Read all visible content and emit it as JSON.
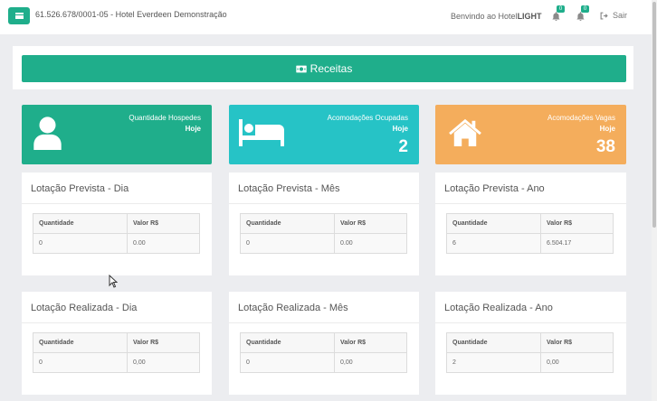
{
  "header": {
    "site_title": "61.526.678/0001-05 - Hotel Everdeen Demonstração",
    "welcome_prefix": "Benvindo ao Hotel",
    "welcome_brand": "LIGHT",
    "notifications_badge_1": "0",
    "notifications_badge_2": "0",
    "logout_label": "Sair"
  },
  "receitas": {
    "label": "Receitas"
  },
  "stats": [
    {
      "label": "Quantidade Hospedes",
      "period": "Hoje",
      "value": "",
      "icon": "user-icon",
      "color": "#1fae8b"
    },
    {
      "label": "Acomodações Ocupadas",
      "period": "Hoje",
      "value": "2",
      "icon": "bed-icon",
      "color": "#26c3c6"
    },
    {
      "label": "Acomodações Vagas",
      "period": "Hoje",
      "value": "38",
      "icon": "home-icon",
      "color": "#f4ad5c"
    }
  ],
  "cards": {
    "columns": [
      "Quantidade",
      "Valor R$"
    ],
    "prevista_dia": {
      "title": "Lotação Prevista - Dia",
      "quantidade": "0",
      "valor": "0.00"
    },
    "prevista_mes": {
      "title": "Lotação Prevista - Mês",
      "quantidade": "0",
      "valor": "0.00"
    },
    "prevista_ano": {
      "title": "Lotação Prevista - Ano",
      "quantidade": "6",
      "valor": "6.504.17"
    },
    "realizada_dia": {
      "title": "Lotação Realizada - Dia",
      "quantidade": "0",
      "valor": "0,00"
    },
    "realizada_mes": {
      "title": "Lotação Realizada - Mês",
      "quantidade": "0",
      "valor": "0,00"
    },
    "realizada_ano": {
      "title": "Lotação Realizada - Ano",
      "quantidade": "2",
      "valor": "0,00"
    }
  }
}
